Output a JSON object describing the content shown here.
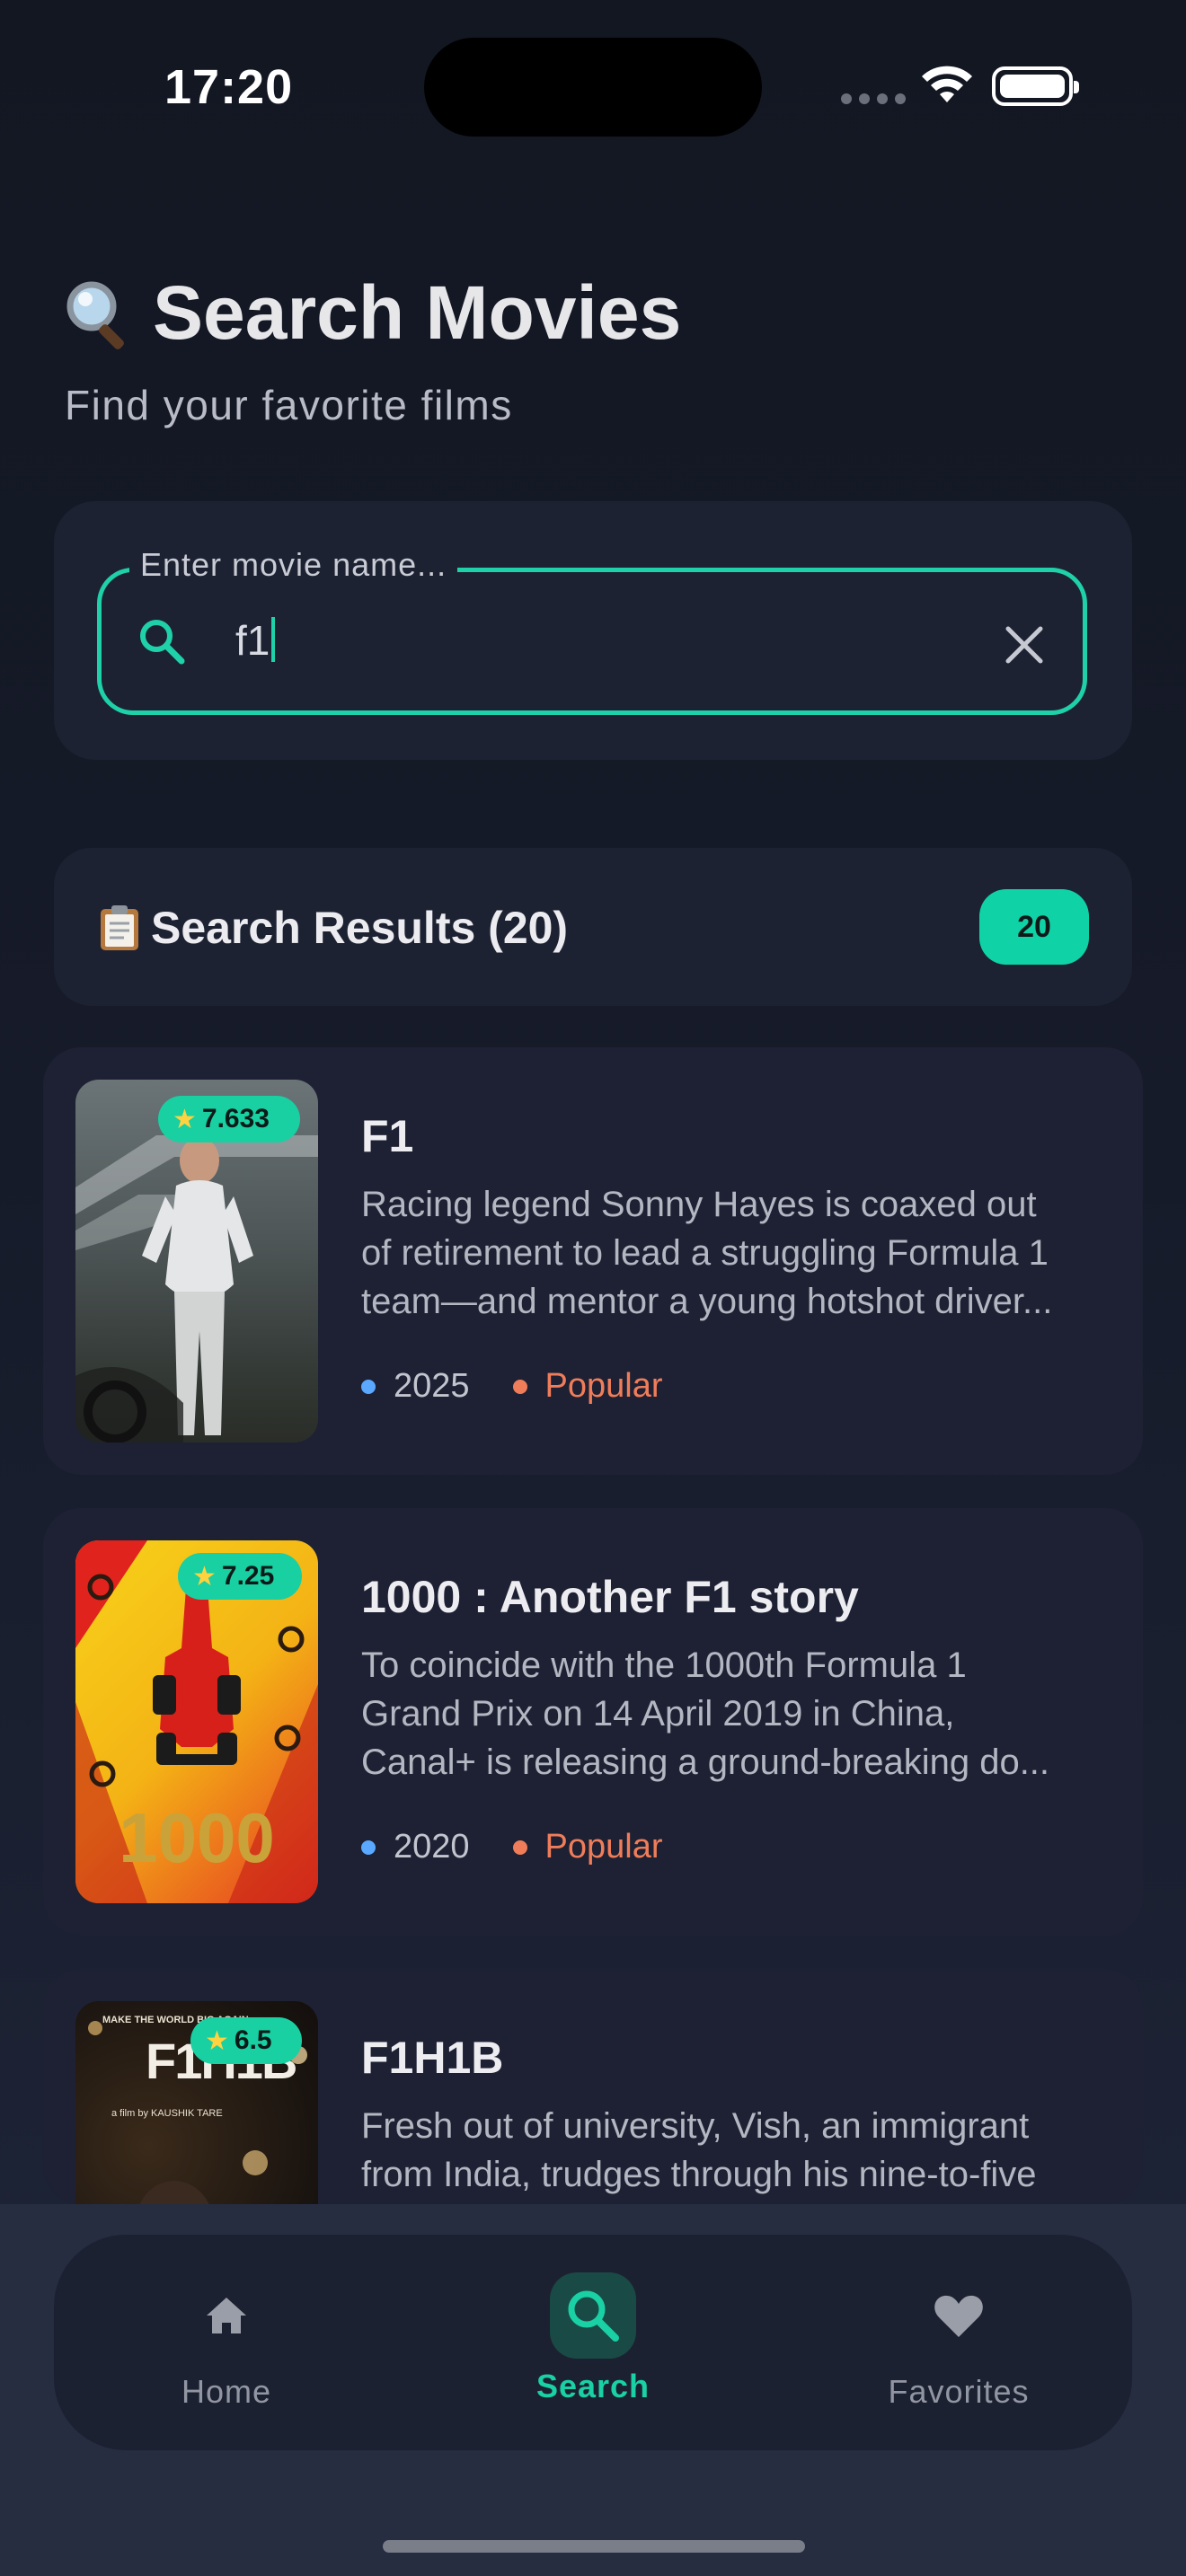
{
  "status": {
    "time": "17:20"
  },
  "header": {
    "title_icon": "magnifier-icon",
    "title": "Search Movies",
    "subtitle": "Find your favorite films"
  },
  "search": {
    "label": "Enter movie name...",
    "value": "f1"
  },
  "results": {
    "title": "Search Results (20)",
    "count": "20"
  },
  "movies": [
    {
      "title": "F1",
      "rating": "7.633",
      "description_lines": [
        "Racing legend Sonny Hayes is coaxed out",
        "of retirement to lead a struggling Formula 1",
        "team—and mentor a young hotshot driver..."
      ],
      "year": "2025",
      "tag": "Popular"
    },
    {
      "title": "1000 : Another F1 story",
      "rating": "7.25",
      "description_lines": [
        "To coincide with the 1000th Formula 1",
        "Grand Prix on 14 April 2019 in China,",
        "Canal+ is releasing a ground-breaking do..."
      ],
      "year": "2020",
      "tag": "Popular"
    },
    {
      "title": "F1H1B",
      "rating": "6.5",
      "description_lines": [
        "Fresh out of university, Vish, an immigrant",
        "from India, trudges through his nine-to-five"
      ],
      "poster_text": "F1H1B"
    }
  ],
  "nav": {
    "home": "Home",
    "search": "Search",
    "favorites": "Favorites"
  },
  "colors": {
    "accent": "#19d1a4",
    "popular": "#f07d5a",
    "year_dot": "#5aa8ff"
  }
}
